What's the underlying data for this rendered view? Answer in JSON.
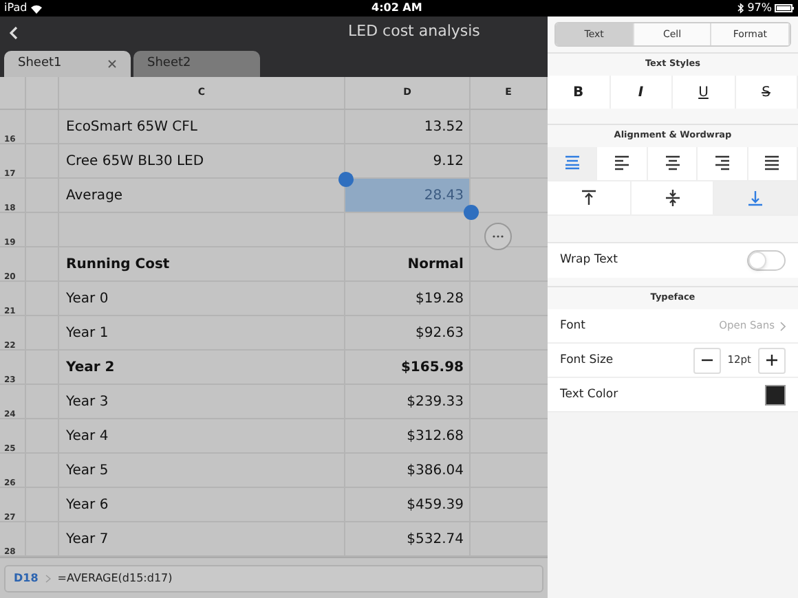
{
  "status_bar": {
    "device": "iPad",
    "time": "4:02 AM",
    "battery": "97%"
  },
  "title_bar": {
    "title": "LED cost analysis"
  },
  "sheet_tabs": [
    {
      "label": "Sheet1",
      "selected": true
    },
    {
      "label": "Sheet2",
      "selected": false
    }
  ],
  "columns": [
    "C",
    "D",
    "E"
  ],
  "rows": [
    {
      "number": "16",
      "label": "EcoSmart 65W CFL",
      "value": "13.52",
      "bold": false,
      "selected": false
    },
    {
      "number": "17",
      "label": "Cree 65W BL30 LED",
      "value": "9.12",
      "bold": false,
      "selected": false
    },
    {
      "number": "18",
      "label": "Average",
      "value": "28.43",
      "bold": false,
      "selected": true
    },
    {
      "number": "19",
      "selected": false
    },
    {
      "number": "20",
      "label": "Running Cost",
      "value": "Normal",
      "bold": true,
      "selected": false
    },
    {
      "number": "21",
      "label": "Year 0",
      "value": "$19.28",
      "bold": false,
      "selected": false
    },
    {
      "number": "22",
      "label": "Year 1",
      "value": "$92.63",
      "bold": false,
      "selected": false
    },
    {
      "number": "23",
      "label": "Year 2",
      "value": "$165.98",
      "bold": true,
      "selected": false
    },
    {
      "number": "24",
      "label": "Year 3",
      "value": "$239.33",
      "bold": false,
      "selected": false
    },
    {
      "number": "25",
      "label": "Year 4",
      "value": "$312.68",
      "bold": false,
      "selected": false
    },
    {
      "number": "26",
      "label": "Year 5",
      "value": "$386.04",
      "bold": false,
      "selected": false
    },
    {
      "number": "27",
      "label": "Year 6",
      "value": "$459.39",
      "bold": false,
      "selected": false
    },
    {
      "number": "28",
      "label": "Year 7",
      "value": "$532.74",
      "bold": false,
      "selected": false
    }
  ],
  "formula_bar": {
    "cell": "D18",
    "formula": "=AVERAGE(d15:d17)"
  },
  "panel": {
    "tabs": [
      {
        "label": "Text",
        "selected": true
      },
      {
        "label": "Cell",
        "selected": false
      },
      {
        "label": "Format",
        "selected": false
      }
    ],
    "text_styles": {
      "title": "Text Styles",
      "buttons": [
        {
          "kind": "bold",
          "label": "B"
        },
        {
          "kind": "italic",
          "label": "I"
        },
        {
          "kind": "underline",
          "label": "U"
        },
        {
          "kind": "strike",
          "label": "S"
        }
      ]
    },
    "alignment": {
      "title": "Alignment & Wordwrap",
      "horizontal": [
        {
          "kind": "wrap",
          "selected": true
        },
        {
          "kind": "left",
          "selected": false
        },
        {
          "kind": "center",
          "selected": false
        },
        {
          "kind": "right",
          "selected": false
        },
        {
          "kind": "justify",
          "selected": false
        }
      ],
      "vertical": [
        {
          "kind": "top",
          "selected": false
        },
        {
          "kind": "middle",
          "selected": false
        },
        {
          "kind": "bottom",
          "selected": true
        }
      ]
    },
    "wrap_text": {
      "label": "Wrap Text",
      "on": false
    },
    "typeface": {
      "title": "Typeface",
      "font_label": "Font",
      "font_value": "Open Sans",
      "size_label": "Font Size",
      "size_value": "12pt",
      "color_label": "Text Color",
      "color": "#222222"
    }
  }
}
